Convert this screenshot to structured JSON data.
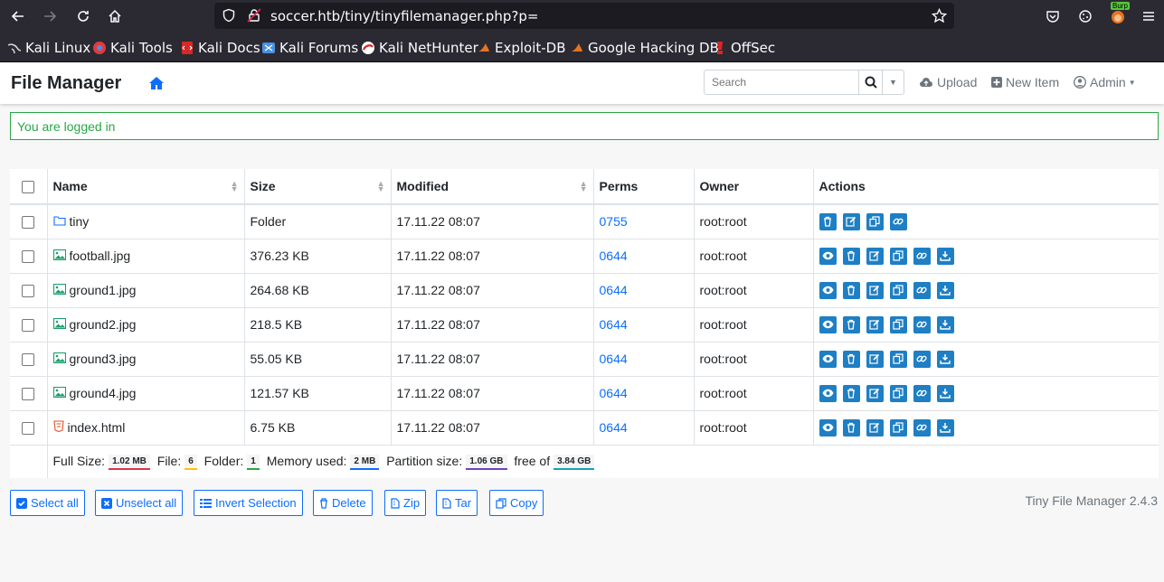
{
  "browser": {
    "url": "soccer.htb/tiny/tinyfilemanager.php?p=",
    "extension_badge": "Burp",
    "bookmarks": [
      {
        "label": "Kali Linux",
        "color": "#d9d9d9"
      },
      {
        "label": "Kali Tools",
        "color": "#e23b3b"
      },
      {
        "label": "Kali Docs",
        "color": "#d92626"
      },
      {
        "label": "Kali Forums",
        "color": "#4a90e2"
      },
      {
        "label": "Kali NetHunter",
        "color": "#d92626"
      },
      {
        "label": "Exploit-DB",
        "color": "#e8731f"
      },
      {
        "label": "Google Hacking DB",
        "color": "#e8731f"
      },
      {
        "label": "OffSec",
        "color": "#d92626"
      }
    ]
  },
  "app": {
    "brand": "File Manager",
    "search_placeholder": "Search",
    "nav": {
      "upload": "Upload",
      "new_item": "New Item",
      "admin": "Admin"
    },
    "alert": "You are logged in"
  },
  "table": {
    "headers": {
      "name": "Name",
      "size": "Size",
      "modified": "Modified",
      "perms": "Perms",
      "owner": "Owner",
      "actions": "Actions"
    },
    "rows": [
      {
        "name": "tiny",
        "type": "folder",
        "size": "Folder",
        "modified": "17.11.22 08:07",
        "perms": "0755",
        "owner": "root:root"
      },
      {
        "name": "football.jpg",
        "type": "image",
        "size": "376.23 KB",
        "modified": "17.11.22 08:07",
        "perms": "0644",
        "owner": "root:root"
      },
      {
        "name": "ground1.jpg",
        "type": "image",
        "size": "264.68 KB",
        "modified": "17.11.22 08:07",
        "perms": "0644",
        "owner": "root:root"
      },
      {
        "name": "ground2.jpg",
        "type": "image",
        "size": "218.5 KB",
        "modified": "17.11.22 08:07",
        "perms": "0644",
        "owner": "root:root"
      },
      {
        "name": "ground3.jpg",
        "type": "image",
        "size": "55.05 KB",
        "modified": "17.11.22 08:07",
        "perms": "0644",
        "owner": "root:root"
      },
      {
        "name": "ground4.jpg",
        "type": "image",
        "size": "121.57 KB",
        "modified": "17.11.22 08:07",
        "perms": "0644",
        "owner": "root:root"
      },
      {
        "name": "index.html",
        "type": "html",
        "size": "6.75 KB",
        "modified": "17.11.22 08:07",
        "perms": "0644",
        "owner": "root:root"
      }
    ],
    "footer": {
      "full_size_label": "Full Size:",
      "full_size_value": "1.02 MB",
      "file_label": "File:",
      "file_value": "6",
      "folder_label": "Folder:",
      "folder_value": "1",
      "memory_label": "Memory used:",
      "memory_value": "2 MB",
      "partition_label": "Partition size:",
      "partition_value": "1.06 GB",
      "free_label": "free of",
      "free_value": "3.84 GB"
    }
  },
  "buttons": {
    "select_all": "Select all",
    "unselect_all": "Unselect all",
    "invert_selection": "Invert Selection",
    "delete": "Delete",
    "zip": "Zip",
    "tar": "Tar",
    "copy": "Copy"
  },
  "version": "Tiny File Manager 2.4.3",
  "colors": {
    "accent": "#0d6efd",
    "action_btn": "#1e7fc4",
    "alert": "#28a745",
    "badge_full_size": "#dc3545",
    "badge_file": "#ffc107",
    "badge_folder": "#28a745",
    "badge_memory": "#0d6efd",
    "badge_partition": "#6f42c1",
    "badge_free": "#17a2b8"
  }
}
